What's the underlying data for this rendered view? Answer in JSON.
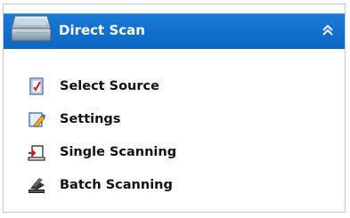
{
  "panel": {
    "title": "Direct Scan",
    "header_icon": "scanner-icon",
    "collapse_icon": "double-chevron-up-icon",
    "colors": {
      "header": "#0c65c2",
      "border": "#c8c8c8",
      "title_text": "#ffffff"
    }
  },
  "items": [
    {
      "label": "Select Source",
      "icon": "select-source-icon"
    },
    {
      "label": "Settings",
      "icon": "settings-icon"
    },
    {
      "label": "Single Scanning",
      "icon": "single-scanning-icon"
    },
    {
      "label": "Batch Scanning",
      "icon": "batch-scanning-icon"
    }
  ]
}
